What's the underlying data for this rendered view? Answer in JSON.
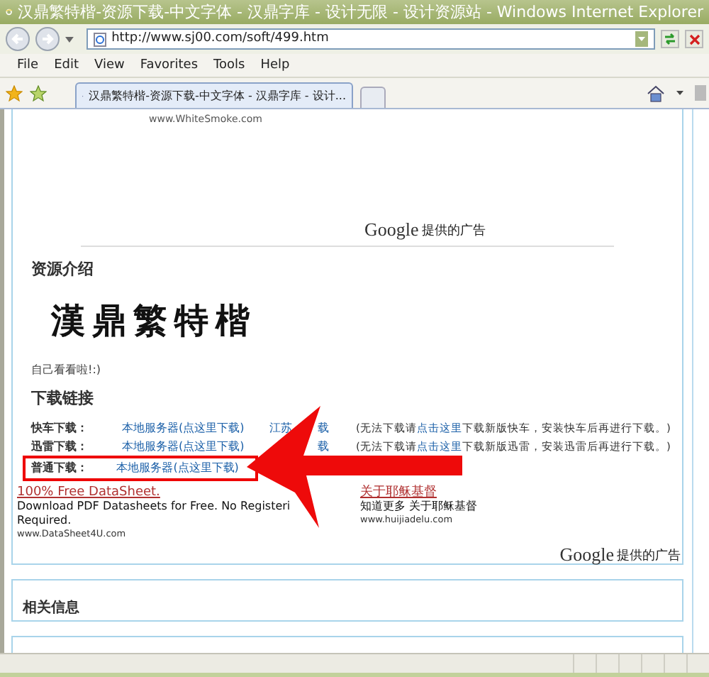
{
  "window": {
    "title": "汉鼎繁特楷-资源下载-中文字体 - 汉鼎字库 - 设计无限 - 设计资源站 - Windows Internet Explorer"
  },
  "address": {
    "value": "http://www.sj00.com/soft/499.htm"
  },
  "menu": [
    "File",
    "Edit",
    "View",
    "Favorites",
    "Tools",
    "Help"
  ],
  "tabs": [
    {
      "label": "汉鼎繁特楷-资源下载-中文字体 - 汉鼎字库 - 设计...",
      "selected": true
    }
  ],
  "page": {
    "top_ad_url": "www.WhiteSmoke.com",
    "ad_brand": "Google",
    "ad_label": "提供的广告",
    "intro_heading": "资源介绍",
    "font_sample": "漢鼎繁特楷",
    "intro_text": "自己看看啦!:)",
    "download_heading": "下载链接",
    "downloads": [
      {
        "label": "快车下载：",
        "link": "本地服务器(点这里下载)",
        "mirror": [
          "江苏",
          "载"
        ],
        "note_before": "(无法下载请",
        "note_link": "点击这里",
        "note_after": "下载新版快车，安装快车后再进行下载。)",
        "highlighted": false
      },
      {
        "label": "迅雷下载：",
        "link": "本地服务器(点这里下载)",
        "mirror": [
          "载"
        ],
        "note_before": "(无法下载请",
        "note_link": "点击这里",
        "note_after": "下载新版迅雷，安装迅雷后再进行下载。)",
        "highlighted": false
      },
      {
        "label": "普通下载：",
        "link": "本地服务器(点这里下载)",
        "highlighted": true
      }
    ],
    "ads": [
      {
        "title": "100% Free DataSheet.",
        "lines": [
          "Download PDF Datasheets for Free. No Registeri",
          "Required."
        ],
        "url": "www.DataSheet4U.com"
      },
      {
        "title": "关于耶稣基督",
        "lines": [
          "知道更多  关于耶稣基督"
        ],
        "url": "www.huijiadelu.com"
      }
    ],
    "ad_brand_2": "Google",
    "ad_label_2": "提供的广告",
    "related_heading": "相关信息"
  }
}
